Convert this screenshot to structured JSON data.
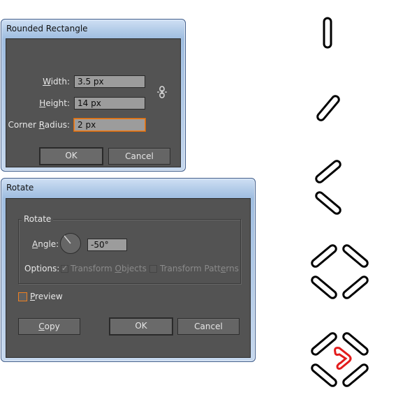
{
  "rounded_rect_dialog": {
    "title": "Rounded Rectangle",
    "width_label_u": "W",
    "width_label_rest": "idth:",
    "width_value": "3.5 px",
    "height_label_u": "H",
    "height_label_rest": "eight:",
    "height_value": "14 px",
    "radius_label_pre": "Corner ",
    "radius_label_u": "R",
    "radius_label_rest": "adius:",
    "radius_value": "2 px",
    "ok_label": "OK",
    "cancel_label": "Cancel",
    "constrain_icon": "chain-link-icon"
  },
  "rotate_dialog": {
    "title": "Rotate",
    "group_title": "Rotate",
    "angle_label_u": "A",
    "angle_label_rest": "ngle:",
    "angle_value": "-50°",
    "options_label": "Options:",
    "transform_objects_pre": "Transform ",
    "transform_objects_u": "O",
    "transform_objects_rest": "bjects",
    "transform_objects_checked": true,
    "transform_patterns_pre": "Transform Patt",
    "transform_patterns_u": "e",
    "transform_patterns_rest": "rns",
    "transform_patterns_checked": false,
    "preview_u": "P",
    "preview_rest": "review",
    "preview_checked": false,
    "copy_u": "C",
    "copy_rest": "opy",
    "ok_label": "OK",
    "cancel_label": "Cancel"
  },
  "steps": {
    "stroke_color": "#000000",
    "highlight_color": "#e31b1b",
    "shapes": [
      "vertical-pill",
      "rotated-pill",
      "chevron-pair",
      "diamond-of-four-pills",
      "diamond-with-red-heart"
    ]
  }
}
